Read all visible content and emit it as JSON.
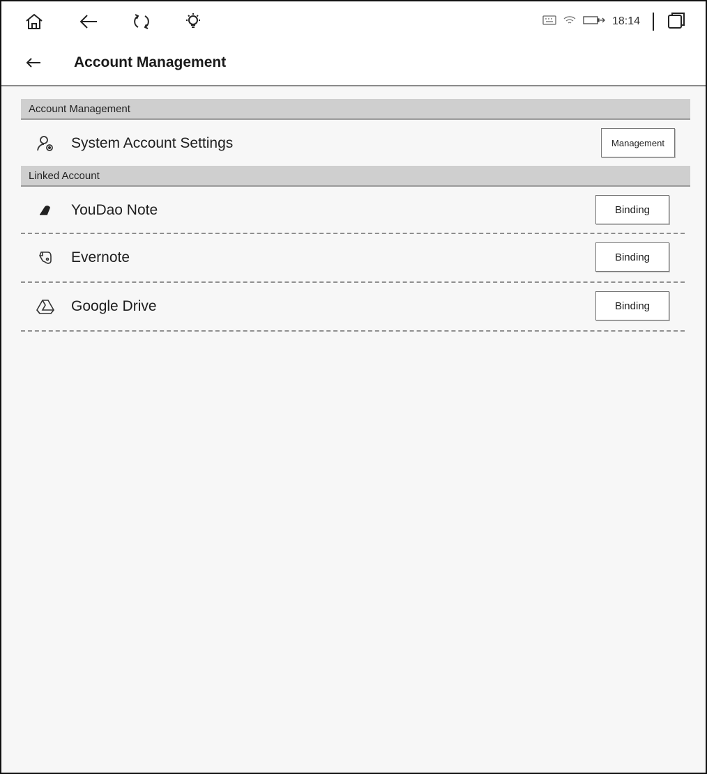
{
  "status_bar": {
    "time": "18:14",
    "left_icons": [
      "home-icon",
      "back-arrow-icon",
      "refresh-icon",
      "lightbulb-icon"
    ],
    "right_icons": [
      "keyboard-icon",
      "wifi-icon",
      "battery-icon",
      "window-icon"
    ]
  },
  "header": {
    "title": "Account Management",
    "back_icon": "back-arrow-icon"
  },
  "sections": [
    {
      "title": "Account Management",
      "items": [
        {
          "label": "System Account Settings",
          "icon": "user-settings-icon",
          "button": "Management"
        }
      ]
    },
    {
      "title": "Linked Account",
      "items": [
        {
          "label": "YouDao Note",
          "icon": "youdao-icon",
          "button": "Binding"
        },
        {
          "label": "Evernote",
          "icon": "evernote-icon",
          "button": "Binding"
        },
        {
          "label": "Google Drive",
          "icon": "google-drive-icon",
          "button": "Binding"
        }
      ]
    }
  ]
}
